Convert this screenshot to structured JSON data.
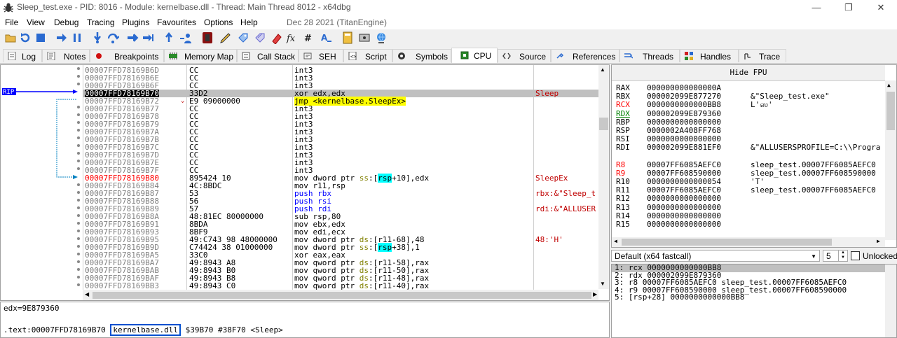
{
  "window": {
    "title": "Sleep_test.exe - PID: 8016 - Module: kernelbase.dll - Thread: Main Thread 8012 - x64dbg",
    "minimize": "—",
    "restore": "❐",
    "close": "✕"
  },
  "menu": {
    "items": [
      "File",
      "View",
      "Debug",
      "Tracing",
      "Plugins",
      "Favourites",
      "Options",
      "Help"
    ],
    "date": "Dec 28 2021 (TitanEngine)"
  },
  "tabs": [
    {
      "label": "Log",
      "icon": "log-icon"
    },
    {
      "label": "Notes",
      "icon": "notes-icon"
    },
    {
      "label": "Breakpoints",
      "icon": "breakpoint-icon"
    },
    {
      "label": "Memory Map",
      "icon": "memory-map-icon"
    },
    {
      "label": "Call Stack",
      "icon": "call-stack-icon"
    },
    {
      "label": "SEH",
      "icon": "seh-icon"
    },
    {
      "label": "Script",
      "icon": "script-icon"
    },
    {
      "label": "Symbols",
      "icon": "symbols-icon"
    },
    {
      "label": "CPU",
      "icon": "cpu-icon",
      "active": true
    },
    {
      "label": "Source",
      "icon": "source-icon"
    },
    {
      "label": "References",
      "icon": "references-icon"
    },
    {
      "label": "Threads",
      "icon": "threads-icon"
    },
    {
      "label": "Handles",
      "icon": "handles-icon"
    },
    {
      "label": "Trace",
      "icon": "trace-icon"
    }
  ],
  "disasm": {
    "rip_label": "RIP",
    "rows": [
      {
        "addr": "00007FFD78169B6D",
        "bytes": "CC",
        "instr": "int3",
        "comment": ""
      },
      {
        "addr": "00007FFD78169B6E",
        "bytes": "CC",
        "instr": "int3",
        "comment": ""
      },
      {
        "addr": "00007FFD78169B6F",
        "bytes": "CC",
        "instr": "int3",
        "comment": ""
      },
      {
        "addr": "00007FFD78169B70",
        "bytes": "33D2",
        "instr": "xor edx,edx",
        "comment": "Sleep",
        "rip": true
      },
      {
        "addr": "00007FFD78169B72",
        "bytes": "E9 09000000",
        "instr": "jmp <kernelbase.SleepEx>",
        "comment": "",
        "jump": true
      },
      {
        "addr": "00007FFD78169B77",
        "bytes": "CC",
        "instr": "int3",
        "comment": ""
      },
      {
        "addr": "00007FFD78169B78",
        "bytes": "CC",
        "instr": "int3",
        "comment": ""
      },
      {
        "addr": "00007FFD78169B79",
        "bytes": "CC",
        "instr": "int3",
        "comment": ""
      },
      {
        "addr": "00007FFD78169B7A",
        "bytes": "CC",
        "instr": "int3",
        "comment": ""
      },
      {
        "addr": "00007FFD78169B7B",
        "bytes": "CC",
        "instr": "int3",
        "comment": ""
      },
      {
        "addr": "00007FFD78169B7C",
        "bytes": "CC",
        "instr": "int3",
        "comment": ""
      },
      {
        "addr": "00007FFD78169B7D",
        "bytes": "CC",
        "instr": "int3",
        "comment": ""
      },
      {
        "addr": "00007FFD78169B7E",
        "bytes": "CC",
        "instr": "int3",
        "comment": ""
      },
      {
        "addr": "00007FFD78169B7F",
        "bytes": "CC",
        "instr": "int3",
        "comment": ""
      },
      {
        "addr": "00007FFD78169B80",
        "bytes": "895424 10",
        "instr": "mov dword ptr ss:[rsp+10],edx",
        "comment": "SleepEx",
        "label": true
      },
      {
        "addr": "00007FFD78169B84",
        "bytes": "4C:8BDC",
        "instr": "mov r11,rsp",
        "comment": ""
      },
      {
        "addr": "00007FFD78169B87",
        "bytes": "53",
        "instr": "push rbx",
        "comment": "rbx:&\"Sleep_t",
        "push": true
      },
      {
        "addr": "00007FFD78169B88",
        "bytes": "56",
        "instr": "push rsi",
        "comment": "",
        "push": true
      },
      {
        "addr": "00007FFD78169B89",
        "bytes": "57",
        "instr": "push rdi",
        "comment": "rdi:&\"ALLUSER",
        "push": true
      },
      {
        "addr": "00007FFD78169B8A",
        "bytes": "48:81EC 80000000",
        "instr": "sub rsp,80",
        "comment": ""
      },
      {
        "addr": "00007FFD78169B91",
        "bytes": "8BDA",
        "instr": "mov ebx,edx",
        "comment": ""
      },
      {
        "addr": "00007FFD78169B93",
        "bytes": "8BF9",
        "instr": "mov edi,ecx",
        "comment": ""
      },
      {
        "addr": "00007FFD78169B95",
        "bytes": "49:C743 98 48000000",
        "instr": "mov dword ptr ds:[r11-68],48",
        "comment": "48:'H'"
      },
      {
        "addr": "00007FFD78169B9D",
        "bytes": "C74424 38 01000000",
        "instr": "mov dword ptr ss:[rsp+38],1",
        "comment": ""
      },
      {
        "addr": "00007FFD78169BA5",
        "bytes": "33C0",
        "instr": "xor eax,eax",
        "comment": ""
      },
      {
        "addr": "00007FFD78169BA7",
        "bytes": "49:8943 A8",
        "instr": "mov qword ptr ds:[r11-58],rax",
        "comment": ""
      },
      {
        "addr": "00007FFD78169BAB",
        "bytes": "49:8943 B0",
        "instr": "mov qword ptr ds:[r11-50],rax",
        "comment": ""
      },
      {
        "addr": "00007FFD78169BAF",
        "bytes": "49:8943 B8",
        "instr": "mov qword ptr ds:[r11-48],rax",
        "comment": ""
      },
      {
        "addr": "00007FFD78169BB3",
        "bytes": "49:8943 C0",
        "instr": "mov qword ptr ds:[r11-40],rax",
        "comment": ""
      }
    ]
  },
  "info": {
    "line1": "edx=9E879360",
    "prefix": ".text:00007FFD78169B70",
    "module": "kernelbase.dll",
    "suffix": "$39B70 #38F70 <Sleep>"
  },
  "registers": {
    "hide_fpu": "Hide FPU",
    "rows": [
      {
        "name": "RAX",
        "value": "000000000000000A",
        "comment": ""
      },
      {
        "name": "RBX",
        "value": "000002099E877270",
        "comment": "&\"Sleep_test.exe\""
      },
      {
        "name": "RCX",
        "value": "0000000000000BB8",
        "comment": "L'ஸ'",
        "changed": true
      },
      {
        "name": "RDX",
        "value": "000002099E879360",
        "comment": "",
        "rdx": true
      },
      {
        "name": "RBP",
        "value": "0000000000000000",
        "comment": ""
      },
      {
        "name": "RSP",
        "value": "0000002A408FF768",
        "comment": ""
      },
      {
        "name": "RSI",
        "value": "0000000000000000",
        "comment": ""
      },
      {
        "name": "RDI",
        "value": "000002099E881EF0",
        "comment": "&\"ALLUSERSPROFILE=C:\\\\Progra"
      },
      {
        "name": "",
        "value": "",
        "comment": ""
      },
      {
        "name": "R8",
        "value": "00007FF6085AEFC0",
        "comment": "sleep_test.00007FF6085AEFC0",
        "changed": true
      },
      {
        "name": "R9",
        "value": "00007FF608590000",
        "comment": "sleep_test.00007FF608590000",
        "changed": true
      },
      {
        "name": "R10",
        "value": "0000000000000054",
        "comment": "'T'"
      },
      {
        "name": "R11",
        "value": "00007FF6085AEFC0",
        "comment": "sleep_test.00007FF6085AEFC0"
      },
      {
        "name": "R12",
        "value": "0000000000000000",
        "comment": ""
      },
      {
        "name": "R13",
        "value": "0000000000000000",
        "comment": ""
      },
      {
        "name": "R14",
        "value": "0000000000000000",
        "comment": ""
      },
      {
        "name": "R15",
        "value": "0000000000000000",
        "comment": ""
      }
    ]
  },
  "callconv": {
    "selected": "Default (x64 fastcall)",
    "count": "5",
    "unlocked_label": "Unlocked"
  },
  "args": [
    "1: rcx 0000000000000BB8",
    "2: rdx 000002099E879360",
    "3: r8 00007FF6085AEFC0 sleep_test.00007FF6085AEFC0",
    "4: r9 00007FF608590000 sleep_test.00007FF608590000",
    "5: [rsp+28] 0000000000000BB8"
  ]
}
